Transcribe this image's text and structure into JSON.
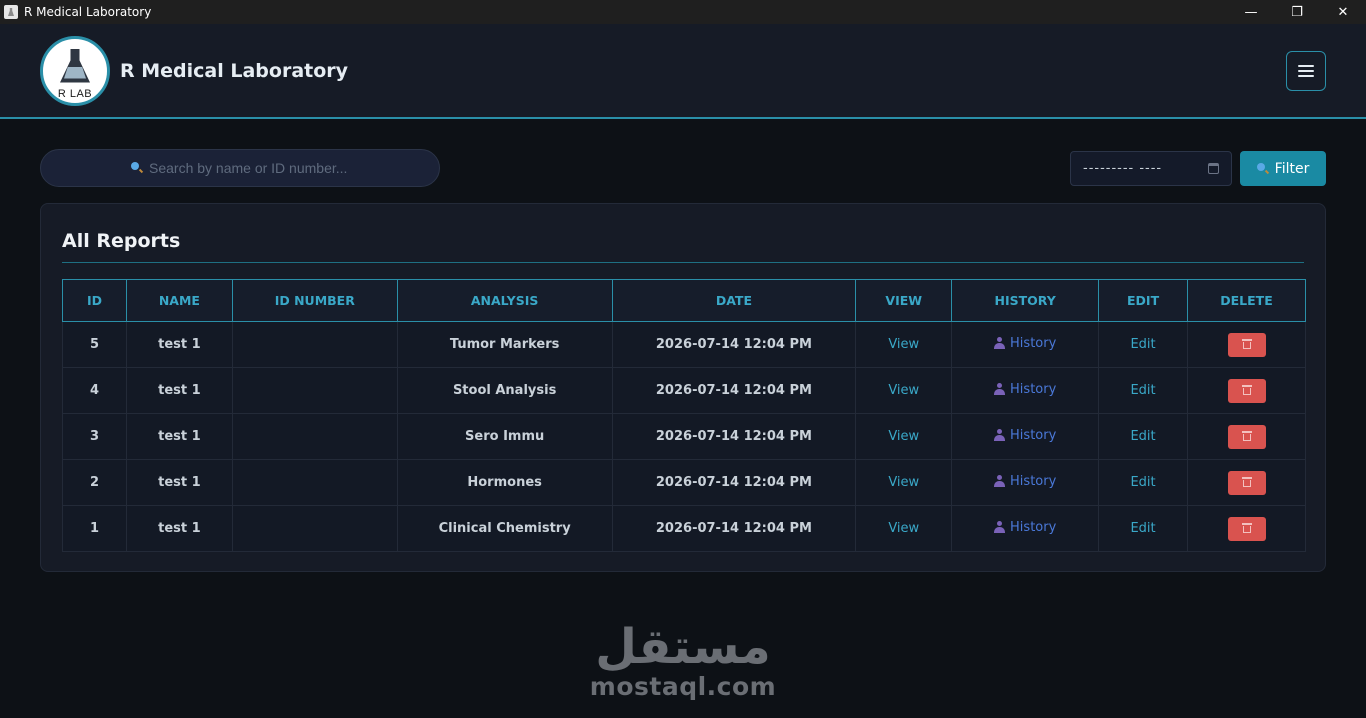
{
  "window": {
    "title": "R Medical Laboratory",
    "controls": {
      "minimize": "—",
      "maximize": "❐",
      "close": "✕"
    }
  },
  "header": {
    "brand_name": "R Medical Laboratory",
    "logo_text": "R LAB"
  },
  "toolbar": {
    "search_placeholder": "Search by name or ID number...",
    "date_value": "---------  ----",
    "filter_label": "Filter"
  },
  "reports": {
    "title": "All Reports",
    "columns": [
      "ID",
      "NAME",
      "ID NUMBER",
      "ANALYSIS",
      "DATE",
      "VIEW",
      "HISTORY",
      "EDIT",
      "DELETE"
    ],
    "rows": [
      {
        "id": "5",
        "name": "test 1",
        "id_number": "",
        "analysis": "Tumor Markers",
        "date": "2026-07-14 12:04 PM",
        "view": "View",
        "history": "History",
        "edit": "Edit"
      },
      {
        "id": "4",
        "name": "test 1",
        "id_number": "",
        "analysis": "Stool Analysis",
        "date": "2026-07-14 12:04 PM",
        "view": "View",
        "history": "History",
        "edit": "Edit"
      },
      {
        "id": "3",
        "name": "test 1",
        "id_number": "",
        "analysis": "Sero Immu",
        "date": "2026-07-14 12:04 PM",
        "view": "View",
        "history": "History",
        "edit": "Edit"
      },
      {
        "id": "2",
        "name": "test 1",
        "id_number": "",
        "analysis": "Hormones",
        "date": "2026-07-14 12:04 PM",
        "view": "View",
        "history": "History",
        "edit": "Edit"
      },
      {
        "id": "1",
        "name": "test 1",
        "id_number": "",
        "analysis": "Clinical Chemistry",
        "date": "2026-07-14 12:04 PM",
        "view": "View",
        "history": "History",
        "edit": "Edit"
      }
    ]
  },
  "watermark": {
    "arabic": "مستقل",
    "latin": "mostaql.com"
  },
  "colors": {
    "accent": "#2a8fa8",
    "filter_button": "#1a8aa3",
    "delete_button": "#d9534f",
    "link": "#3aa8c8",
    "history_link": "#4a78d8"
  }
}
